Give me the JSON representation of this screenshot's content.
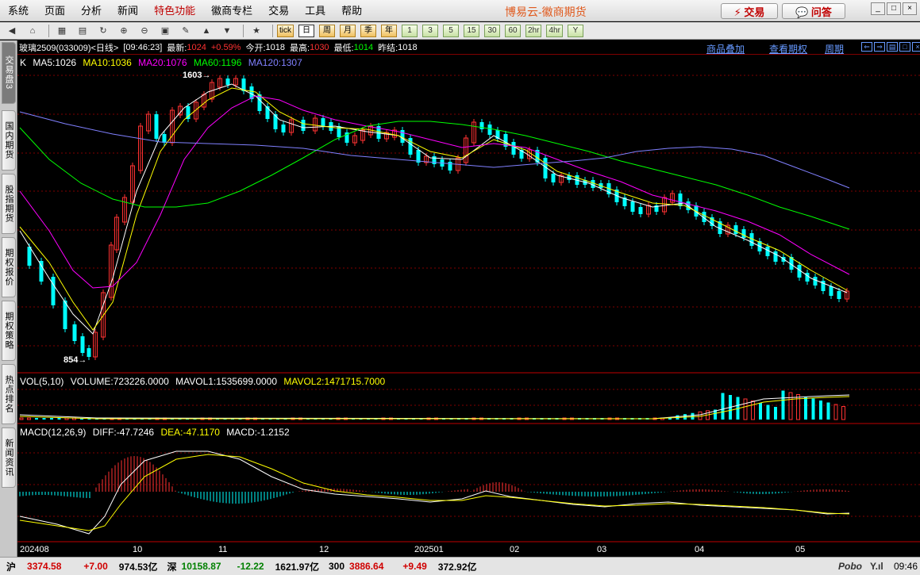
{
  "menu": [
    "系统",
    "页面",
    "分析",
    "新闻",
    "特色功能",
    "徽商专栏",
    "交易",
    "工具",
    "帮助"
  ],
  "brand": "博易云-徽商期货",
  "buttons": {
    "trade": "⚡ 交易",
    "ask": "💬 问答"
  },
  "window_controls": [
    "_",
    "□",
    "×"
  ],
  "toolbar": {
    "icons": [
      "back-icon",
      "home-icon",
      "database-icon",
      "news-icon",
      "refresh-icon",
      "zoom-in-icon",
      "zoom-out-icon",
      "window-icon",
      "pen-icon",
      "chart-tool-icon",
      "filter-icon",
      "new-icon"
    ],
    "periods": [
      "tick",
      "日",
      "周",
      "月",
      "季",
      "年",
      "1",
      "3",
      "5",
      "15",
      "30",
      "60",
      "2hr",
      "4hr",
      "Y"
    ],
    "active_period": "日"
  },
  "sidebar_tabs": [
    "交易盘3",
    "国内期货",
    "股指期货",
    "期权报价",
    "期权策略",
    "热点排名",
    "新闻资讯"
  ],
  "quote": {
    "name": "玻璃2509(033009)<日线>",
    "time": "[09:46:23]",
    "latest_label": "最新:",
    "latest": "1024",
    "change": "+0.59%",
    "open_label": "今开:",
    "open": "1018",
    "high_label": "最高:",
    "high": "1030",
    "low_label": "最低:",
    "low": "1014",
    "prev_label": "昨结:",
    "prev": "1018"
  },
  "links": [
    "商品叠加",
    "查看期权",
    "周期"
  ],
  "ma": {
    "k": "K",
    "ma5": "MA5:1026",
    "ma10": "MA10:1036",
    "ma20": "MA20:1076",
    "ma60": "MA60:1196",
    "ma120": "MA120:1307"
  },
  "price_annotations": {
    "high": "1603",
    "low": "854"
  },
  "volume": {
    "title": "VOL(5,10)",
    "volume": "VOLUME:723226.0000",
    "mavol1": "MAVOL1:1535699.0000",
    "mavol2": "MAVOL2:1471715.7000"
  },
  "macd": {
    "title": "MACD(12,26,9)",
    "diff": "DIFF:-47.7246",
    "dea": "DEA:-47.1170",
    "macd": "MACD:-1.2152"
  },
  "x_labels": [
    "202408",
    "10",
    "11",
    "12",
    "202501",
    "02",
    "03",
    "04",
    "05"
  ],
  "status": {
    "sh_label": "沪",
    "sh_value": "3374.58",
    "sh_change": "+7.00",
    "sh_amount": "974.53亿",
    "sz_label": "深",
    "sz_value": "10158.87",
    "sz_change": "-12.22",
    "sz_amount": "1621.97亿",
    "c300_label": "300",
    "c300_value": "3886.64",
    "c300_change": "+9.49",
    "c300_amount": "372.92亿",
    "logo": "Pobo",
    "signal": "Y.ıl",
    "time": "09:46"
  },
  "colors": {
    "up": "#ff3232",
    "down": "#00ffff",
    "ma5": "#ffffff",
    "ma10": "#ffff00",
    "ma20": "#ff00ff",
    "ma60": "#00ff00",
    "ma120": "#8080ff",
    "grid": "#800000"
  }
}
